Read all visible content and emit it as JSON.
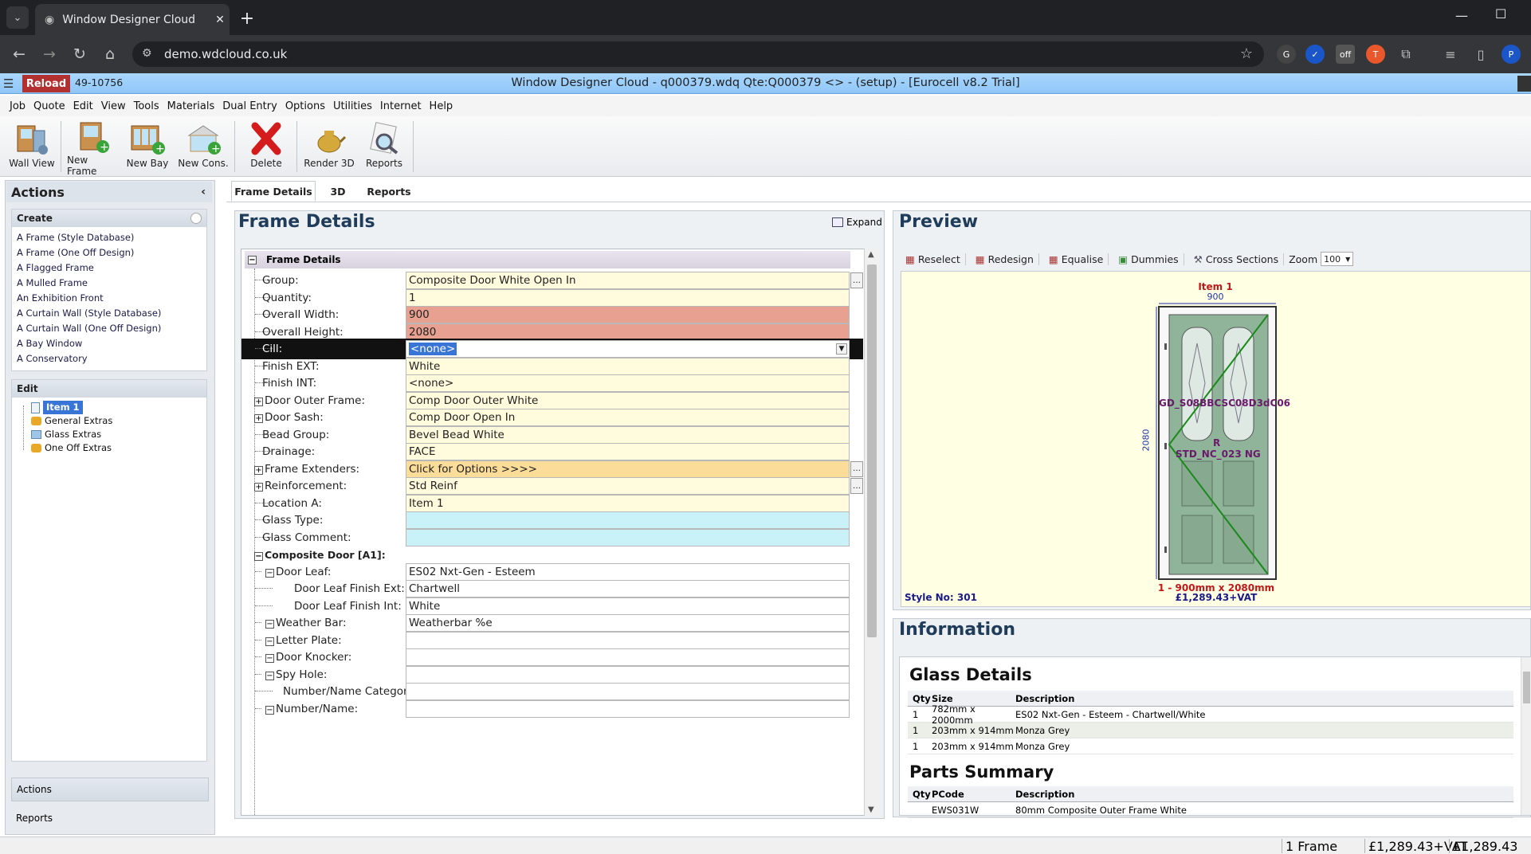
{
  "browser": {
    "tab_title": "Window Designer Cloud",
    "url": "demo.wdcloud.co.uk",
    "profile_initial": "P"
  },
  "app": {
    "reload_label": "Reload",
    "job_code": "49-10756",
    "title": "Window Designer Cloud - q000379.wdq Qte:Q000379 <> - (setup) - [Eurocell v8.2 Trial]"
  },
  "menu": [
    "Job",
    "Quote",
    "Edit",
    "View",
    "Tools",
    "Materials",
    "Dual Entry",
    "Options",
    "Utilities",
    "Internet",
    "Help"
  ],
  "toolbar": {
    "wall_view": "Wall View",
    "new_frame": "New Frame",
    "new_bay": "New Bay",
    "new_cons": "New Cons.",
    "delete": "Delete",
    "render_3d": "Render 3D",
    "reports": "Reports"
  },
  "left": {
    "actions_title": "Actions",
    "create_title": "Create",
    "create_items": [
      "A Frame (Style Database)",
      "A Frame (One Off Design)",
      "A Flagged Frame",
      "A Mulled Frame",
      "An Exhibition Front",
      "A Curtain Wall (Style Database)",
      "A Curtain Wall (One Off Design)",
      "A Bay Window",
      "A Conservatory"
    ],
    "edit_title": "Edit",
    "tree": [
      "Item 1",
      "General Extras",
      "Glass Extras",
      "One Off Extras"
    ],
    "bottom_actions": "Actions",
    "bottom_reports": "Reports"
  },
  "tabs": [
    "Frame Details",
    "3D",
    "Reports"
  ],
  "frame": {
    "panel_title": "Frame Details",
    "expand": "Expand",
    "section": "Frame Details",
    "rows": [
      {
        "label": "Group:",
        "value": "Composite Door White Open In"
      },
      {
        "label": "Quantity:",
        "value": "1"
      },
      {
        "label": "Overall Width:",
        "value": "900"
      },
      {
        "label": "Overall Height:",
        "value": "2080"
      },
      {
        "label": "Cill:",
        "value": "<none>"
      },
      {
        "label": "Finish EXT:",
        "value": "White"
      },
      {
        "label": "Finish INT:",
        "value": "<none>"
      },
      {
        "label": "Door Outer Frame:",
        "value": "Comp Door Outer White"
      },
      {
        "label": "Door Sash:",
        "value": "Comp Door Open In"
      },
      {
        "label": "Bead Group:",
        "value": "Bevel Bead White"
      },
      {
        "label": "Drainage:",
        "value": "FACE"
      },
      {
        "label": "Frame Extenders:",
        "value": "Click for Options >>>>"
      },
      {
        "label": "Reinforcement:",
        "value": "Std Reinf"
      },
      {
        "label": "Location A:",
        "value": "Item 1"
      },
      {
        "label": "Glass Type:",
        "value": ""
      },
      {
        "label": "Glass Comment:",
        "value": ""
      },
      {
        "label": "Composite Door [A1]:",
        "value": ""
      },
      {
        "label": "Door Leaf:",
        "value": "ES02 Nxt-Gen - Esteem"
      },
      {
        "label": "Door Leaf Finish Ext:",
        "value": "Chartwell"
      },
      {
        "label": "Door Leaf Finish Int:",
        "value": "White"
      },
      {
        "label": "Weather Bar:",
        "value": "Weatherbar %e"
      },
      {
        "label": "Letter Plate:",
        "value": ""
      },
      {
        "label": "Door Knocker:",
        "value": ""
      },
      {
        "label": "Spy Hole:",
        "value": ""
      },
      {
        "label": "Number/Name Category:",
        "value": ""
      },
      {
        "label": "Number/Name:",
        "value": ""
      }
    ]
  },
  "preview": {
    "title": "Preview",
    "tools": [
      "Reselect",
      "Redesign",
      "Equalise",
      "Dummies",
      "Cross Sections"
    ],
    "zoom_label": "Zoom",
    "zoom_value": "100",
    "item_label": "Item 1",
    "width_dim": "900",
    "height_dim": "2080",
    "glass_label_left": "GD_S08BBCSC08D3dC06",
    "glass_label_r": "R",
    "glass_label_ng": "STD_NC_023 NG",
    "size_caption": "1 - 900mm x 2080mm",
    "price_caption": "£1,289.43+VAT",
    "style_no": "Style No: 301"
  },
  "info": {
    "title": "Information",
    "glass_heading": "Glass Details",
    "glass_cols": [
      "Qty",
      "Size",
      "Description"
    ],
    "glass_rows": [
      [
        "1",
        "782mm x 2000mm",
        "ES02 Nxt-Gen - Esteem - Chartwell/White"
      ],
      [
        "1",
        "203mm x 914mm",
        "Monza Grey"
      ],
      [
        "1",
        "203mm x 914mm",
        "Monza Grey"
      ]
    ],
    "parts_heading": "Parts Summary",
    "parts_cols": [
      "Qty",
      "PCode",
      "Description"
    ],
    "parts_rows": [
      [
        "",
        "EWS031W",
        "80mm Composite Outer Frame White"
      ]
    ]
  },
  "status": {
    "frames": "1 Frame",
    "price_vat": "£1,289.43+VAT",
    "price": "£1,289.43"
  },
  "colors": {
    "required_field": "#e8a090",
    "optional_field": "#fffbdc",
    "glass_field": "#c8f2f8",
    "options_field": "#fbdc98",
    "selected_row": "#111111",
    "door_green": "#90b49a"
  }
}
